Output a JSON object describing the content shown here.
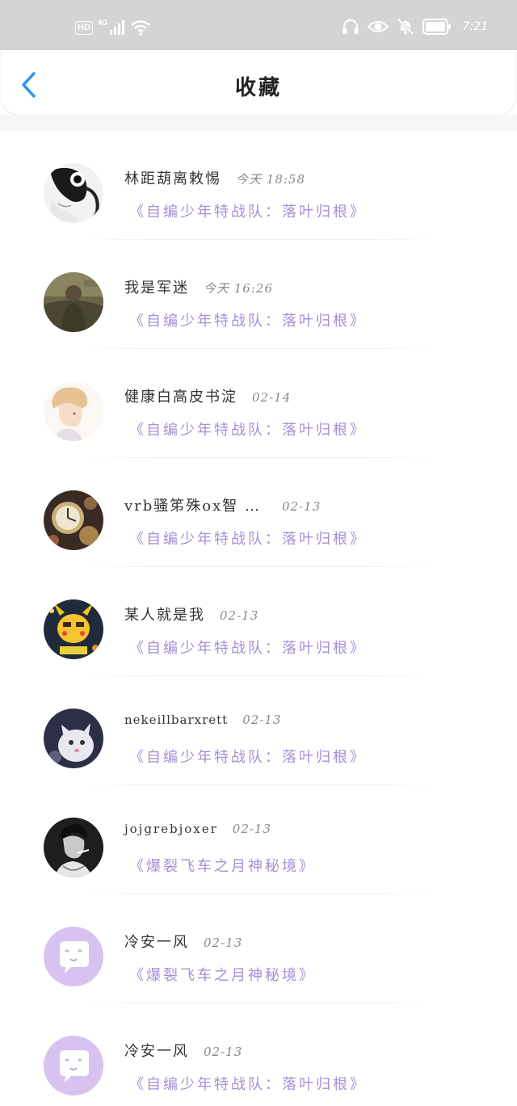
{
  "status_bar": {
    "left_badge": "HD",
    "network": "4G",
    "time": "7:21"
  },
  "header": {
    "title": "收藏",
    "back_icon": "chevron-left-icon"
  },
  "colors": {
    "accent_blue": "#2f96f0",
    "book_purple": "#a58fd6",
    "default_avatar_purple": "#d7c2f0"
  },
  "favorites": [
    {
      "user": "林距葫离敕惕",
      "time": "今天  18:58",
      "book": "《自编少年特战队：落叶归根》",
      "avatar": "bw-girl"
    },
    {
      "user": "我是军迷",
      "time": "今天  16:26",
      "book": "《自编少年特战队：落叶归根》",
      "avatar": "soldier"
    },
    {
      "user": "健康白高皮书淀",
      "time": "02-14",
      "book": "《自编少年特战队：落叶归根》",
      "avatar": "blonde-boy"
    },
    {
      "user": "vrb骚笫殊ox智 …",
      "time": "02-13",
      "book": "《自编少年特战队：落叶归根》",
      "avatar": "clock"
    },
    {
      "user": "某人就是我",
      "time": "02-13",
      "book": "《自编少年特战队：落叶归根》",
      "avatar": "pikachu"
    },
    {
      "user": "nekeillbarxrett",
      "time": "02-13",
      "book": "《自编少年特战队：落叶归根》",
      "avatar": "white-cat"
    },
    {
      "user": "jojgrebjoxer",
      "time": "02-13",
      "book": "《爆裂飞车之月神秘境》",
      "avatar": "smoker"
    },
    {
      "user": "冷安一风",
      "time": "02-13",
      "book": "《爆裂飞车之月神秘境》",
      "avatar": "default"
    },
    {
      "user": "冷安一风",
      "time": "02-13",
      "book": "《自编少年特战队：落叶归根》",
      "avatar": "default"
    }
  ]
}
